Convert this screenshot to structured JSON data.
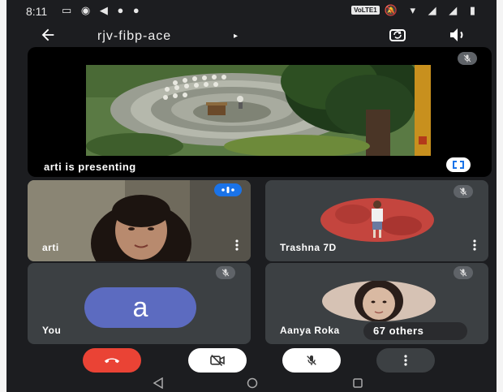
{
  "status_bar": {
    "time": "8:11",
    "left_icons": "▭ ◉ ◀ ● ●",
    "volte": "VoLTE1",
    "right_icons": "🔕 ▾ ◢ ◢ ▮"
  },
  "header": {
    "meeting_title": "rjv-fibp-ace",
    "caret": "▸"
  },
  "presentation": {
    "label": "arti is presenting"
  },
  "participants": [
    {
      "name": "arti",
      "speaking": true
    },
    {
      "name": "Trashna 7D",
      "muted": true
    },
    {
      "name": "You",
      "initial": "a",
      "muted": true
    },
    {
      "name": "Aanya Roka",
      "muted": true
    }
  ],
  "others": {
    "label": "67 others"
  },
  "colors": {
    "end_call": "#ea4335",
    "avatar": "#5c6bc0",
    "speaking": "#1a73e8",
    "tile_bg": "#3c4043"
  },
  "icons": {
    "back": "arrow-left-icon",
    "switch_camera": "camera-switch-icon",
    "speaker": "speaker-icon",
    "mic_off": "mic-off-icon",
    "fullscreen": "fullscreen-icon",
    "end_call": "phone-hangup-icon",
    "camera_off": "camera-off-icon",
    "more": "more-vertical-icon"
  }
}
